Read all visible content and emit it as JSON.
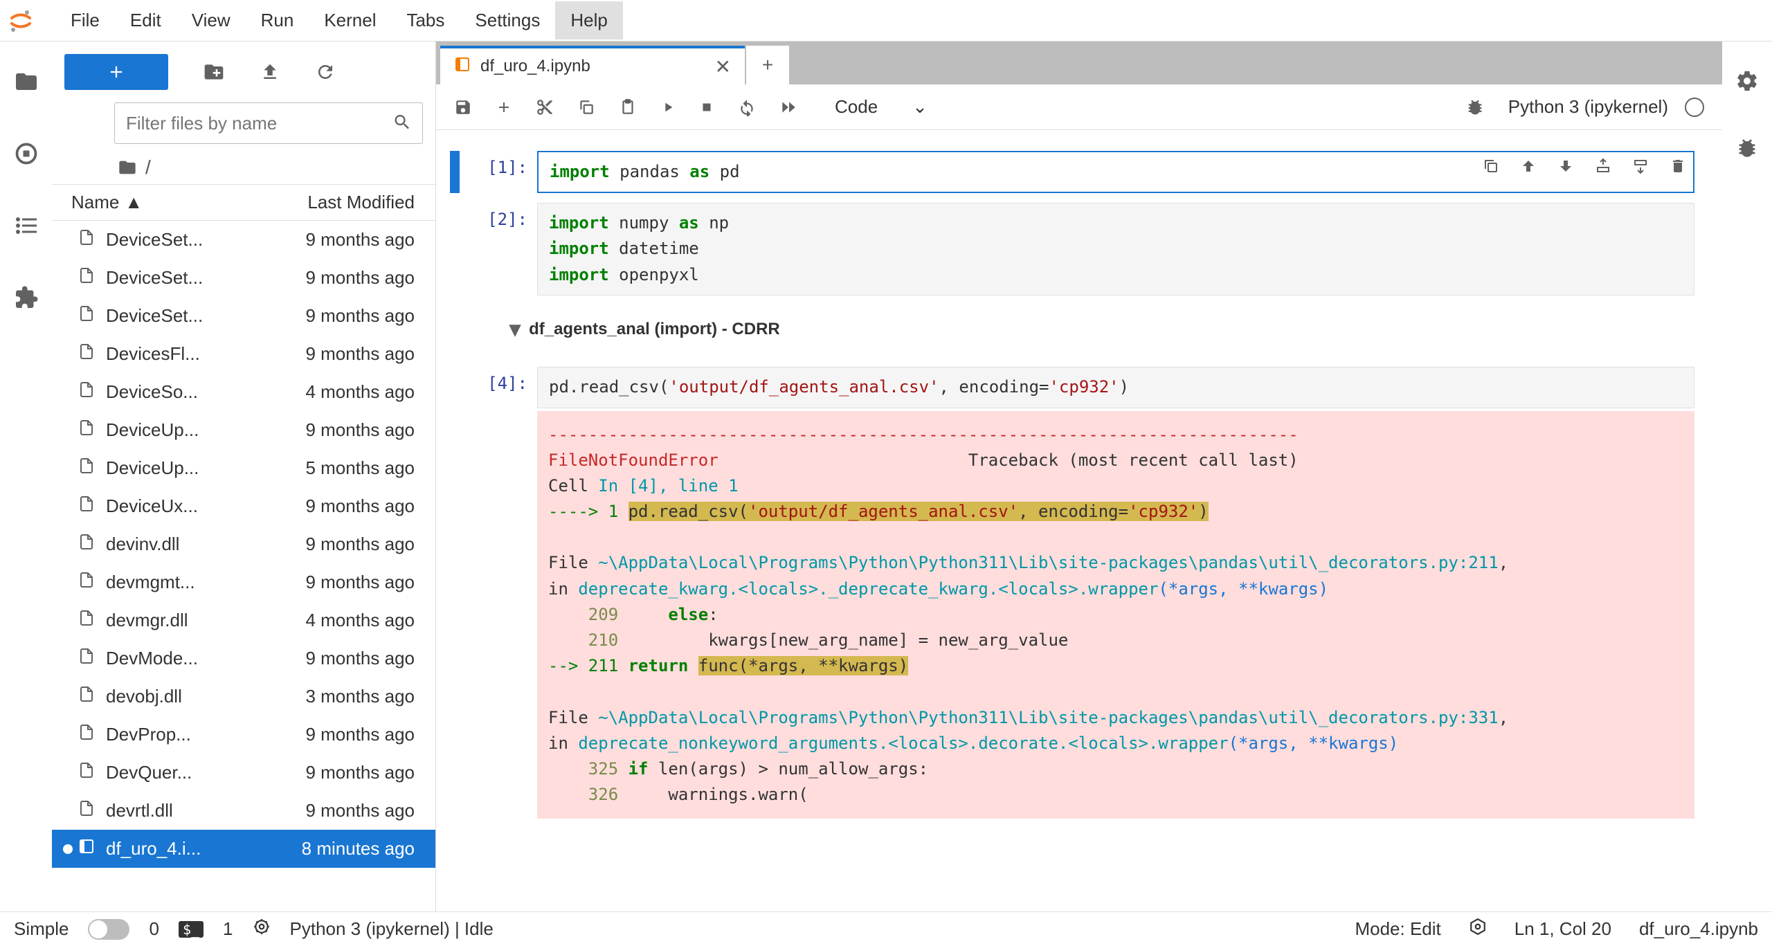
{
  "menu": {
    "items": [
      "File",
      "Edit",
      "View",
      "Run",
      "Kernel",
      "Tabs",
      "Settings",
      "Help"
    ],
    "active_index": 7
  },
  "filebrowser": {
    "filter_placeholder": "Filter files by name",
    "breadcrumb": "/",
    "headers": {
      "name": "Name",
      "modified": "Last Modified"
    },
    "files": [
      {
        "name": "DeviceSet...",
        "modified": "9 months ago",
        "icon": "file"
      },
      {
        "name": "DeviceSet...",
        "modified": "9 months ago",
        "icon": "file"
      },
      {
        "name": "DeviceSet...",
        "modified": "9 months ago",
        "icon": "file"
      },
      {
        "name": "DevicesFl...",
        "modified": "9 months ago",
        "icon": "file"
      },
      {
        "name": "DeviceSo...",
        "modified": "4 months ago",
        "icon": "file"
      },
      {
        "name": "DeviceUp...",
        "modified": "9 months ago",
        "icon": "file"
      },
      {
        "name": "DeviceUp...",
        "modified": "5 months ago",
        "icon": "file"
      },
      {
        "name": "DeviceUx...",
        "modified": "9 months ago",
        "icon": "file"
      },
      {
        "name": "devinv.dll",
        "modified": "9 months ago",
        "icon": "file"
      },
      {
        "name": "devmgmt...",
        "modified": "9 months ago",
        "icon": "file"
      },
      {
        "name": "devmgr.dll",
        "modified": "4 months ago",
        "icon": "file"
      },
      {
        "name": "DevMode...",
        "modified": "9 months ago",
        "icon": "file"
      },
      {
        "name": "devobj.dll",
        "modified": "3 months ago",
        "icon": "file"
      },
      {
        "name": "DevProp...",
        "modified": "9 months ago",
        "icon": "file"
      },
      {
        "name": "DevQuer...",
        "modified": "9 months ago",
        "icon": "file"
      },
      {
        "name": "devrtl.dll",
        "modified": "9 months ago",
        "icon": "file"
      },
      {
        "name": "df_uro_4.i...",
        "modified": "8 minutes ago",
        "icon": "notebook",
        "selected": true,
        "dirty": true
      }
    ]
  },
  "tabs": {
    "open": [
      {
        "title": "df_uro_4.ipynb",
        "icon": "notebook"
      }
    ]
  },
  "toolbar": {
    "celltype": "Code",
    "kernel": "Python 3 (ipykernel)"
  },
  "notebook": {
    "cells": [
      {
        "type": "code",
        "prompt": "[1]:",
        "active": true,
        "source_tokens": [
          [
            "kw",
            "import"
          ],
          [
            "",
            " pandas "
          ],
          [
            "kw",
            "as"
          ],
          [
            "",
            " pd"
          ]
        ]
      },
      {
        "type": "code",
        "prompt": "[2]:",
        "source_lines": [
          [
            [
              "kw",
              "import"
            ],
            [
              "",
              " numpy "
            ],
            [
              "kw",
              "as"
            ],
            [
              "",
              " np"
            ]
          ],
          [
            [
              "kw",
              "import"
            ],
            [
              "",
              " datetime"
            ]
          ],
          [
            [
              "kw",
              "import"
            ],
            [
              "",
              " openpyxl"
            ]
          ]
        ]
      },
      {
        "type": "markdown",
        "heading": "df_agents_anal (import) - CDRR"
      },
      {
        "type": "code",
        "prompt": "[4]:",
        "source_tokens": [
          [
            "",
            "pd.read_csv("
          ],
          [
            "str",
            "'output/df_agents_anal.csv'"
          ],
          [
            "",
            ", encoding="
          ],
          [
            "str",
            "'cp932'"
          ],
          [
            "",
            ")"
          ]
        ],
        "has_error_output": true
      }
    ],
    "error_output": {
      "dash_line": "---------------------------------------------------------------------------",
      "name": "FileNotFoundError",
      "traceback_label": "Traceback (most recent call last)",
      "lines": [
        {
          "html": "Cell <span class='err-cyan'>In [4], line 1</span>"
        },
        {
          "html": "<span class='num'>----> 1</span> <span class='err-hl'>pd.read_csv(<span class='str'>'output/df_agents_anal.csv'</span>, encoding=<span class='str'>'cp932'</span>)</span>"
        },
        {
          "html": ""
        },
        {
          "html": "File <span class='err-cyan'>~\\AppData\\Local\\Programs\\Python\\Python311\\Lib\\site-packages\\pandas\\util\\_decorators.py:211</span>,"
        },
        {
          "html": "in <span class='err-cyan'>deprecate_kwarg.&lt;locals&gt;._deprecate_kwarg.&lt;locals&gt;.wrapper</span><span class='err-blue'>(*args, **kwargs)</span>"
        },
        {
          "html": "    <span style='color:#7a8a4a'>209</span>     <span class='kw'>else</span>:"
        },
        {
          "html": "    <span style='color:#7a8a4a'>210</span>         kwargs[new_arg_name] = new_arg_value"
        },
        {
          "html": "<span class='num'>--> 211</span> <span class='kw'>return</span> <span class='err-hl'>func(*args, **kwargs)</span>"
        },
        {
          "html": ""
        },
        {
          "html": "File <span class='err-cyan'>~\\AppData\\Local\\Programs\\Python\\Python311\\Lib\\site-packages\\pandas\\util\\_decorators.py:331</span>,"
        },
        {
          "html": "in <span class='err-cyan'>deprecate_nonkeyword_arguments.&lt;locals&gt;.decorate.&lt;locals&gt;.wrapper</span><span class='err-blue'>(*args, **kwargs)</span>"
        },
        {
          "html": "    <span style='color:#7a8a4a'>325</span> <span class='kw'>if</span> len(args) &gt; num_allow_args:"
        },
        {
          "html": "    <span style='color:#7a8a4a'>326</span>     warnings.warn("
        }
      ]
    }
  },
  "statusbar": {
    "simple": "Simple",
    "count0": "0",
    "count1": "1",
    "kernel": "Python 3 (ipykernel) | Idle",
    "mode": "Mode: Edit",
    "pos": "Ln 1, Col 20",
    "file": "df_uro_4.ipynb"
  }
}
